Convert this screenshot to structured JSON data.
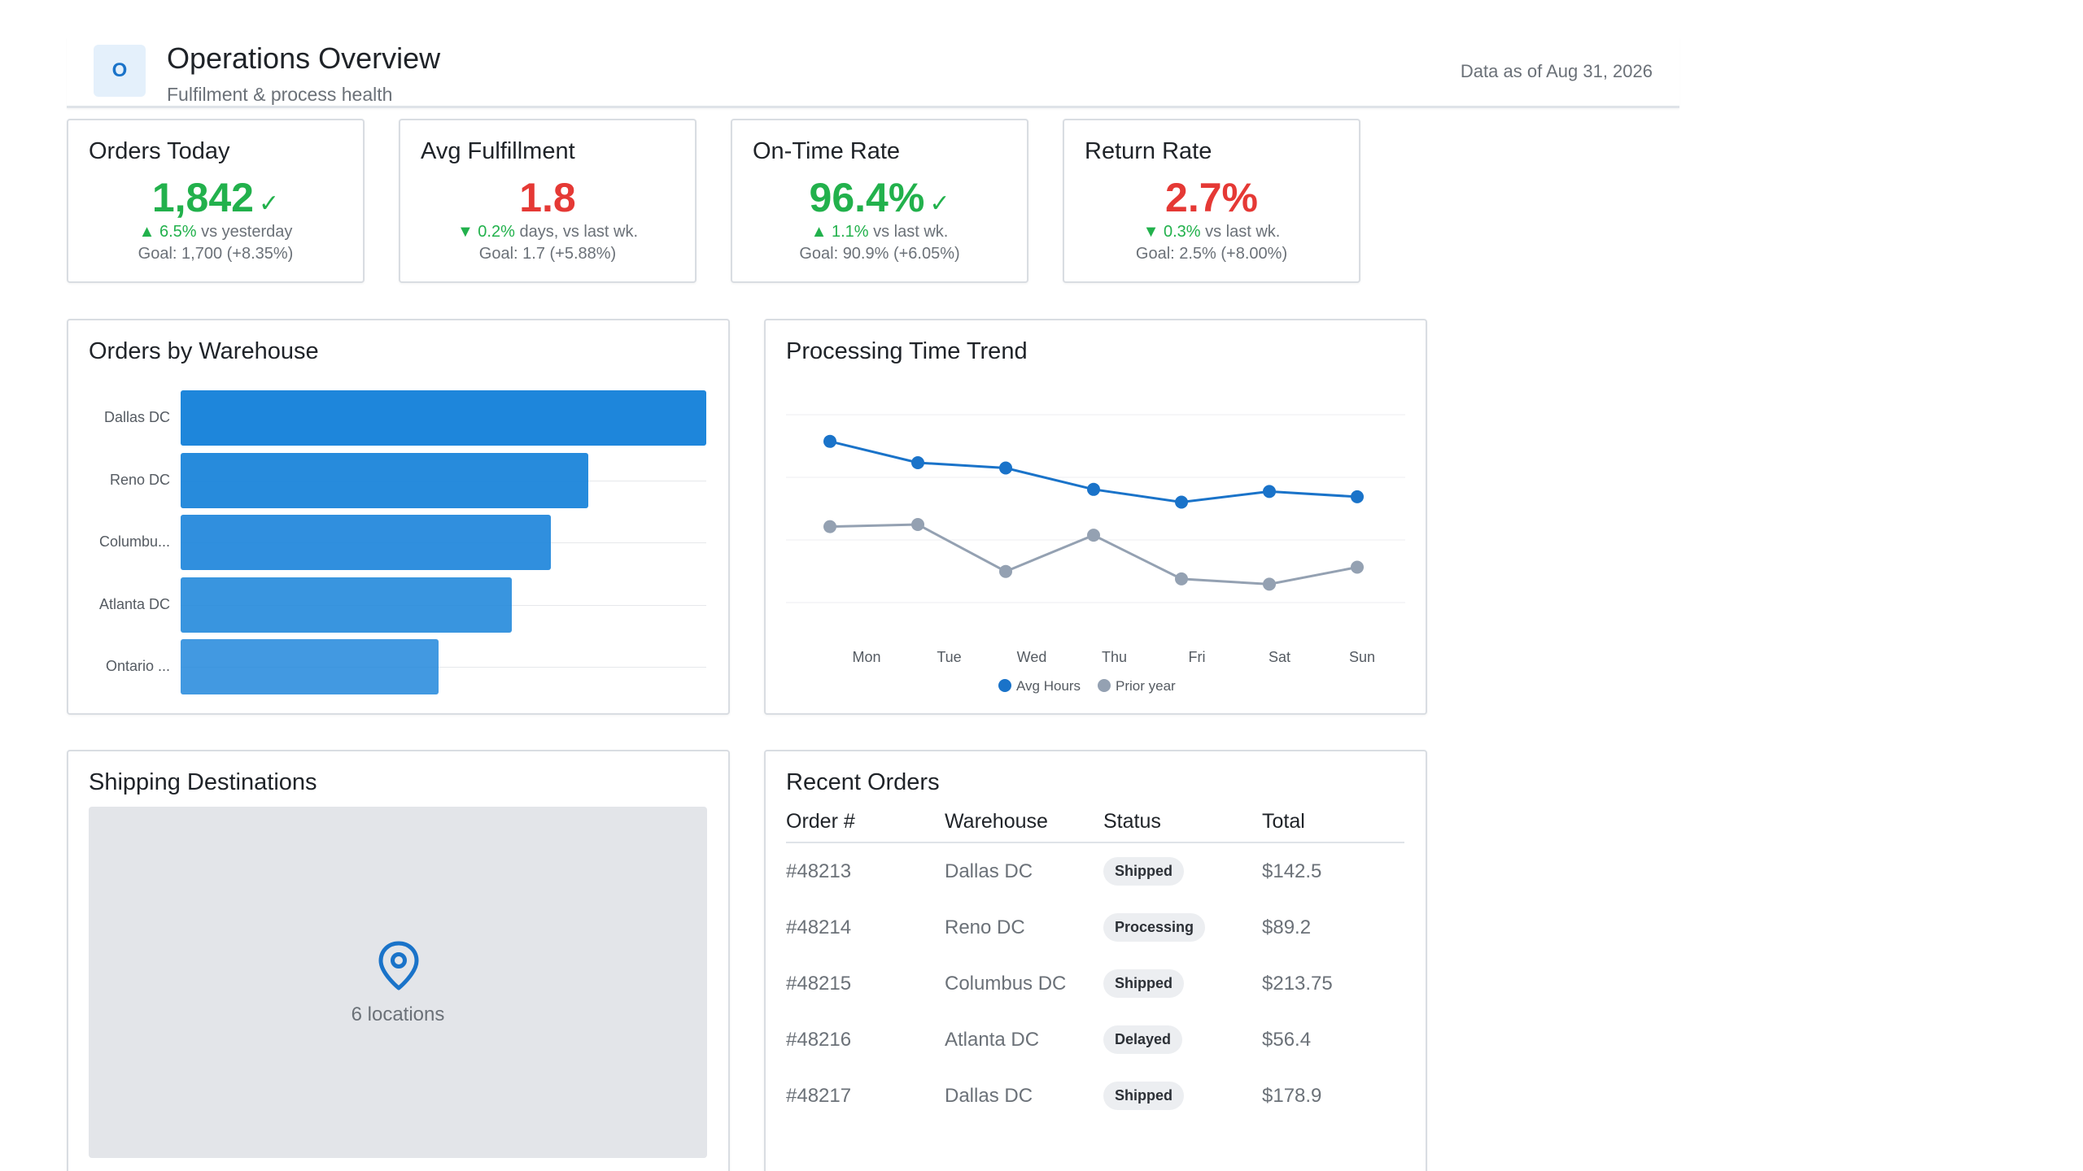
{
  "header": {
    "logo_letter": "O",
    "title": "Operations Overview",
    "subtitle": "Fulfilment & process health",
    "as_of": "Data as of Aug 31, 2026"
  },
  "kpis": [
    {
      "title": "Orders Today",
      "value": "1,842",
      "check": "✓",
      "value_color": "#22b14c",
      "delta_arrow": "▲",
      "delta_value": "6.5%",
      "delta_text": "vs yesterday",
      "delta_color": "#22b14c",
      "goal": "Goal: 1,700 (+8.35%)"
    },
    {
      "title": "Avg Fulfillment",
      "value": "1.8",
      "check": "",
      "value_color": "#e53935",
      "delta_arrow": "▼",
      "delta_value": "0.2%",
      "delta_text": "days, vs last wk.",
      "delta_color": "#22b14c",
      "goal": "Goal: 1.7 (+5.88%)"
    },
    {
      "title": "On-Time Rate",
      "value": "96.4%",
      "check": "✓",
      "value_color": "#22b14c",
      "delta_arrow": "▲",
      "delta_value": "1.1%",
      "delta_text": "vs last wk.",
      "delta_color": "#22b14c",
      "goal": "Goal: 90.9% (+6.05%)"
    },
    {
      "title": "Return Rate",
      "value": "2.7%",
      "check": "",
      "value_color": "#e53935",
      "delta_arrow": "▼",
      "delta_value": "0.3%",
      "delta_text": "vs last wk.",
      "delta_color": "#22b14c",
      "goal": "Goal: 2.5% (+8.00%)"
    }
  ],
  "warehouse_panel": {
    "title": "Orders by Warehouse"
  },
  "trend_panel": {
    "title": "Processing Time Trend"
  },
  "chart_data": [
    {
      "type": "bar",
      "orientation": "horizontal",
      "categories": [
        "Dallas DC",
        "Reno DC",
        "Columbu...",
        "Atlanta DC",
        "Ontario ..."
      ],
      "values": [
        100,
        77.5,
        70.5,
        63,
        49
      ],
      "color": "#1e86db",
      "grid": true
    },
    {
      "type": "line",
      "x": [
        "Mon",
        "Tue",
        "Wed",
        "Thu",
        "Fri",
        "Sat",
        "Sun"
      ],
      "series": [
        {
          "name": "Avg Hours",
          "color": "#1a73c9",
          "values": [
            2.4,
            2.2,
            2.15,
            1.95,
            1.83,
            1.93,
            1.88
          ]
        },
        {
          "name": "Prior year",
          "color": "#94a1b2",
          "values": [
            1.6,
            1.62,
            1.18,
            1.52,
            1.11,
            1.06,
            1.22
          ]
        }
      ],
      "ylim": [
        0.9,
        2.65
      ],
      "grid": true,
      "legend": "bottom"
    }
  ],
  "map_panel": {
    "title": "Shipping Destinations",
    "label": "6 locations",
    "icon": "map-pin-icon",
    "icon_color": "#1a73c9"
  },
  "orders_panel": {
    "title": "Recent Orders",
    "columns": [
      "Order #",
      "Warehouse",
      "Status",
      "Total"
    ],
    "rows": [
      {
        "order": "#48213",
        "warehouse": "Dallas DC",
        "status": "Shipped",
        "total": "$142.5"
      },
      {
        "order": "#48214",
        "warehouse": "Reno DC",
        "status": "Processing",
        "total": "$89.2"
      },
      {
        "order": "#48215",
        "warehouse": "Columbus DC",
        "status": "Shipped",
        "total": "$213.75"
      },
      {
        "order": "#48216",
        "warehouse": "Atlanta DC",
        "status": "Delayed",
        "total": "$56.4"
      },
      {
        "order": "#48217",
        "warehouse": "Dallas DC",
        "status": "Shipped",
        "total": "$178.9"
      }
    ]
  }
}
